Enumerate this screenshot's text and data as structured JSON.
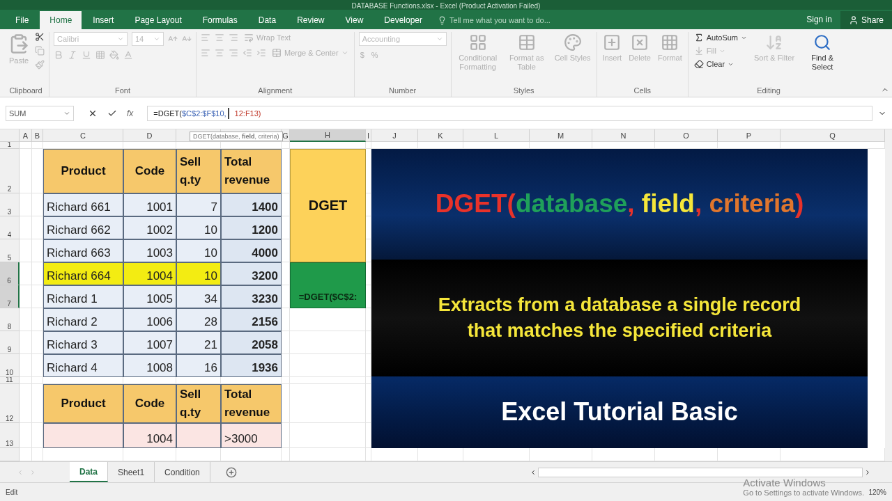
{
  "title_bar": {
    "title": "DATABASE Functions.xlsx - Excel (Product Activation Failed)"
  },
  "tabs": [
    {
      "label": "File",
      "selected": false
    },
    {
      "label": "Home",
      "selected": true
    },
    {
      "label": "Insert",
      "selected": false
    },
    {
      "label": "Page Layout",
      "selected": false
    },
    {
      "label": "Formulas",
      "selected": false
    },
    {
      "label": "Data",
      "selected": false
    },
    {
      "label": "Review",
      "selected": false
    },
    {
      "label": "View",
      "selected": false
    },
    {
      "label": "Developer",
      "selected": false
    }
  ],
  "tell_me": {
    "placeholder": "Tell me what you want to do..."
  },
  "sign_in": "Sign in",
  "share": "Share",
  "ribbon": {
    "clipboard": {
      "label": "Clipboard",
      "paste": {
        "label": "Paste",
        "disabled": true
      }
    },
    "font": {
      "label": "Font",
      "name": "Calibri",
      "size": "14",
      "disabled": true
    },
    "alignment": {
      "label": "Alignment",
      "wrap_text": "Wrap Text",
      "merge": "Merge & Center",
      "disabled": true
    },
    "number": {
      "label": "Number",
      "format": "Accounting",
      "currency": "$",
      "percent": "%",
      "disabled": true
    },
    "styles": {
      "label": "Styles",
      "buttons": [
        {
          "label": "Conditional Formatting",
          "disabled": true
        },
        {
          "label": "Format as Table",
          "disabled": true
        },
        {
          "label": "Cell Styles",
          "disabled": true
        }
      ]
    },
    "cells": {
      "label": "Cells",
      "buttons": [
        {
          "label": "Insert",
          "disabled": true
        },
        {
          "label": "Delete",
          "disabled": true
        },
        {
          "label": "Format",
          "disabled": true
        }
      ]
    },
    "editing": {
      "label": "Editing",
      "buttons": [
        {
          "kind": "small",
          "label": "AutoSum",
          "disabled": false
        },
        {
          "kind": "small",
          "label": "Fill",
          "disabled": true
        },
        {
          "kind": "small",
          "label": "Clear",
          "disabled": false
        },
        {
          "kind": "large",
          "label": "Sort & Filter",
          "disabled": true
        },
        {
          "kind": "large",
          "label": "Find & Select",
          "disabled": false
        }
      ]
    }
  },
  "formula_bar": {
    "name_box": "SUM",
    "insert_function": "fx",
    "formula_parts": [
      {
        "text": "=DGET(",
        "color": "#222222"
      },
      {
        "text": "$C$2:$F$10,",
        "color": "#3a62b5"
      },
      {
        "text": "12:F13)",
        "color": "#c0392b"
      }
    ],
    "tooltip": "DGET(database, **field**, criteria)"
  },
  "columns": [
    {
      "label": "A",
      "selected": false
    },
    {
      "label": "B",
      "selected": false
    },
    {
      "label": "C",
      "selected": false
    },
    {
      "label": "D",
      "selected": false
    },
    {
      "selected": false
    },
    {
      "selected": false
    },
    {
      "label": "G",
      "selected": false
    },
    {
      "label": "H",
      "selected": true
    },
    {
      "label": "I",
      "selected": false
    },
    {
      "label": "J",
      "selected": false
    },
    {
      "label": "K",
      "selected": false
    },
    {
      "label": "L",
      "selected": false
    },
    {
      "label": "M",
      "selected": false
    },
    {
      "label": "N",
      "selected": false
    },
    {
      "label": "O",
      "selected": false
    },
    {
      "label": "P",
      "selected": false
    },
    {
      "label": "Q",
      "selected": false
    }
  ],
  "rows": [
    {
      "label": "1",
      "selected": false
    },
    {
      "label": "2",
      "selected": false
    },
    {
      "label": "3",
      "selected": false
    },
    {
      "label": "4",
      "selected": false
    },
    {
      "label": "5",
      "selected": false
    },
    {
      "label": "6",
      "selected": true
    },
    {
      "label": "7",
      "selected": true
    },
    {
      "label": "8",
      "selected": false
    },
    {
      "label": "9",
      "selected": false
    },
    {
      "label": "10",
      "selected": false
    },
    {
      "label": "11",
      "selected": false
    },
    {
      "label": "12",
      "selected": false
    },
    {
      "label": "13",
      "selected": false
    }
  ],
  "data_table": {
    "columns": [
      "Product",
      "Code",
      "Sell q.ty",
      "Total revenue"
    ],
    "rows": [
      {
        "cells": [
          "Richard 661",
          "1001",
          "7",
          "1400"
        ],
        "highlighted": false
      },
      {
        "cells": [
          "Richard 662",
          "1002",
          "10",
          "1200"
        ],
        "highlighted": false
      },
      {
        "cells": [
          "Richard 663",
          "1003",
          "10",
          "4000"
        ],
        "highlighted": false
      },
      {
        "cells": [
          "Richard 664",
          "1004",
          "10",
          "3200"
        ],
        "highlighted": true
      },
      {
        "cells": [
          "Richard 1",
          "1005",
          "34",
          "3230"
        ],
        "highlighted": false
      },
      {
        "cells": [
          "Richard 2",
          "1006",
          "28",
          "2156"
        ],
        "highlighted": false
      },
      {
        "cells": [
          "Richard 3",
          "1007",
          "21",
          "2058"
        ],
        "highlighted": false
      },
      {
        "cells": [
          "Richard 4",
          "1008",
          "16",
          "1936"
        ],
        "highlighted": false
      }
    ]
  },
  "criteria_table": {
    "columns": [
      "Product",
      "Code",
      "Sell q.ty",
      "Total revenue"
    ],
    "row": {
      "code": "1004",
      "total_revenue": ">3000"
    }
  },
  "dget": {
    "label": "DGET",
    "result": "=DGET($C$2:"
  },
  "banner": {
    "title_parts": [
      {
        "text": "DGET(",
        "color": "#e8322a"
      },
      {
        "text": "database",
        "color": "#1fa05a"
      },
      {
        "text": ", ",
        "color": "#e8322a"
      },
      {
        "text": "field",
        "color": "#f5e63a"
      },
      {
        "text": ", ",
        "color": "#e8322a"
      },
      {
        "text": "criteria",
        "color": "#e0762d"
      },
      {
        "text": ")",
        "color": "#e8322a"
      }
    ],
    "description_lines": [
      "Extracts from a database a single record",
      "that matches the specified criteria"
    ],
    "footer": "Excel Tutorial Basic"
  },
  "sheet_tabs": [
    {
      "label": "Data",
      "selected": true
    },
    {
      "label": "Sheet1",
      "selected": false
    },
    {
      "label": "Condition",
      "selected": false
    }
  ],
  "activation": {
    "title": "Activate Windows",
    "subtitle": "Go to Settings to activate Windows."
  },
  "status_bar": {
    "mode": "Edit",
    "zoom": "120%"
  }
}
